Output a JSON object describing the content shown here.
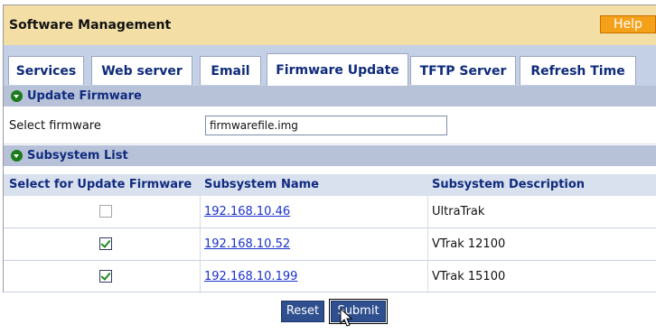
{
  "header": {
    "title": "Software Management",
    "help_label": "Help"
  },
  "tabs": [
    {
      "label": "Services"
    },
    {
      "label": "Web server"
    },
    {
      "label": "Email"
    },
    {
      "label": "Firmware Update",
      "active": true
    },
    {
      "label": "TFTP Server"
    },
    {
      "label": "Refresh Time"
    }
  ],
  "update_section": {
    "title": "Update Firmware",
    "select_label": "Select firmware",
    "file_value": "firmwarefile.img"
  },
  "subsystem_section": {
    "title": "Subsystem List",
    "columns": [
      "Select for Update Firmware",
      "Subsystem Name",
      "Subsystem Description"
    ],
    "rows": [
      {
        "name": "192.168.10.46",
        "description": "UltraTrak",
        "checked": false
      },
      {
        "name": "192.168.10.52",
        "description": "VTrak 12100",
        "checked": true
      },
      {
        "name": "192.168.10.199",
        "description": "VTrak 15100",
        "checked": true
      }
    ]
  },
  "buttons": {
    "reset": "Reset",
    "submit": "Submit"
  },
  "colors": {
    "accent_header": "#f3dea6",
    "help_button": "#f5a019",
    "section_bar": "#b7c1d8",
    "button": "#2f4f8e"
  }
}
